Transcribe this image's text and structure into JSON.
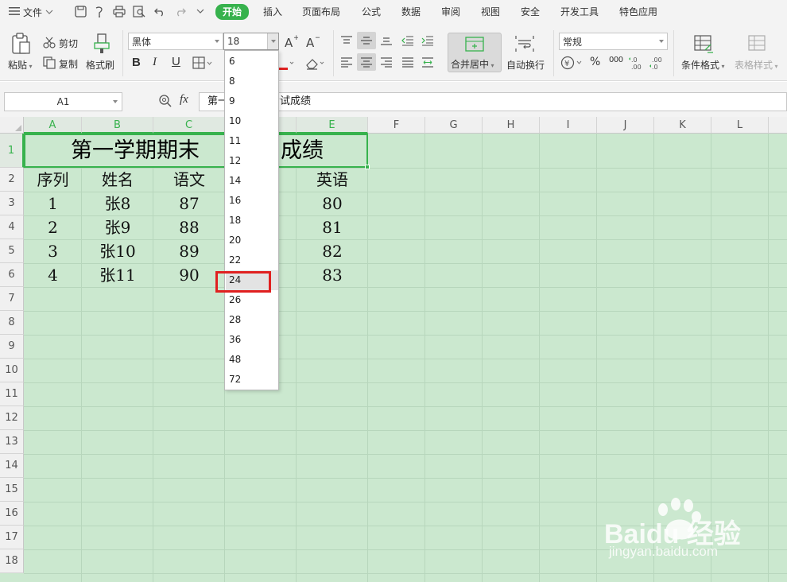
{
  "menubar": {
    "file_label": "文件",
    "tabs": [
      "开始",
      "插入",
      "页面布局",
      "公式",
      "数据",
      "审阅",
      "视图",
      "安全",
      "开发工具",
      "特色应用"
    ]
  },
  "ribbon": {
    "paste": "粘贴",
    "cut": "剪切",
    "copy": "复制",
    "format_painter": "格式刷",
    "font_name": "黑体",
    "font_size": "18",
    "bold": "B",
    "italic": "I",
    "underline": "U",
    "merge_center": "合并居中",
    "wrap_text": "自动换行",
    "number_format": "常规",
    "percent": "%",
    "thousands": "000",
    "cond_format": "条件格式",
    "table_style": "表格样式"
  },
  "formula_bar": {
    "name_box": "A1",
    "fx": "fx",
    "value": "第一学期期末考试成绩"
  },
  "sheet": {
    "columns": [
      "A",
      "B",
      "C",
      "D",
      "E",
      "F",
      "G",
      "H",
      "I",
      "J",
      "K",
      "L"
    ],
    "rows": [
      "1",
      "2",
      "3",
      "4",
      "5",
      "6",
      "7",
      "8",
      "9",
      "10",
      "11",
      "12",
      "13",
      "14",
      "15",
      "16",
      "17",
      "18"
    ],
    "title_left": "第一学期期末",
    "title_right": "成绩",
    "header": {
      "A": "序列",
      "B": "姓名",
      "C": "语文",
      "E": "英语"
    },
    "data": [
      {
        "A": "1",
        "B": "张8",
        "C": "87",
        "E": "80"
      },
      {
        "A": "2",
        "B": "张9",
        "C": "88",
        "E": "81"
      },
      {
        "A": "3",
        "B": "张10",
        "C": "89",
        "E": "82"
      },
      {
        "A": "4",
        "B": "张11",
        "C": "90",
        "E": "83"
      }
    ]
  },
  "font_size_dropdown": {
    "options": [
      "6",
      "8",
      "9",
      "10",
      "11",
      "12",
      "14",
      "16",
      "18",
      "20",
      "22",
      "24",
      "26",
      "28",
      "36",
      "48",
      "72"
    ],
    "highlighted": "24"
  },
  "watermark": {
    "brand": "Baidu 经验",
    "url": "jingyan.baidu.com"
  },
  "colors": {
    "accent": "#37b24d",
    "sheet_bg": "#cbe8cf",
    "highlight_box": "#e02020"
  }
}
